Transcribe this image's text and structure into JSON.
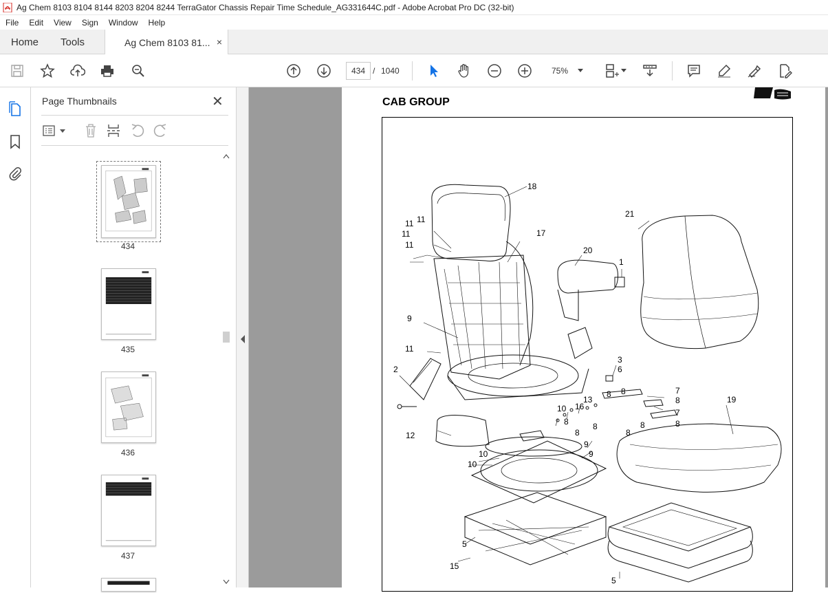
{
  "window": {
    "title": "Ag Chem 8103 8104 8144 8203 8204 8244 TerraGator Chassis Repair Time Schedule_AG331644C.pdf - Adobe Acrobat Pro DC (32-bit)"
  },
  "menu": [
    "File",
    "Edit",
    "View",
    "Sign",
    "Window",
    "Help"
  ],
  "tabs": {
    "home": "Home",
    "tools": "Tools",
    "document": "Ag Chem 8103 81...",
    "close": "×"
  },
  "toolbar": {
    "current_page": "434",
    "page_separator": "/",
    "total_pages": "1040",
    "zoom": "75%"
  },
  "thumbnails_panel": {
    "title": "Page Thumbnails",
    "close": "✕",
    "pages": [
      "434",
      "435",
      "436",
      "437"
    ]
  },
  "document": {
    "section_title": "CAB GROUP",
    "callouts": [
      "18",
      "11",
      "11",
      "11",
      "11",
      "17",
      "21",
      "20",
      "1",
      "9",
      "11",
      "3",
      "6",
      "2",
      "7",
      "8",
      "19",
      "8",
      "8",
      "13",
      "16",
      "10",
      "7",
      "8",
      "8",
      "8",
      "8",
      "8",
      "12",
      "8",
      "10",
      "9",
      "9",
      "10",
      "5",
      "15",
      "5"
    ]
  },
  "colors": {
    "acrobat_red": "#d4261f",
    "accent_blue": "#1473e6",
    "doc_bg": "#9b9b9b"
  }
}
